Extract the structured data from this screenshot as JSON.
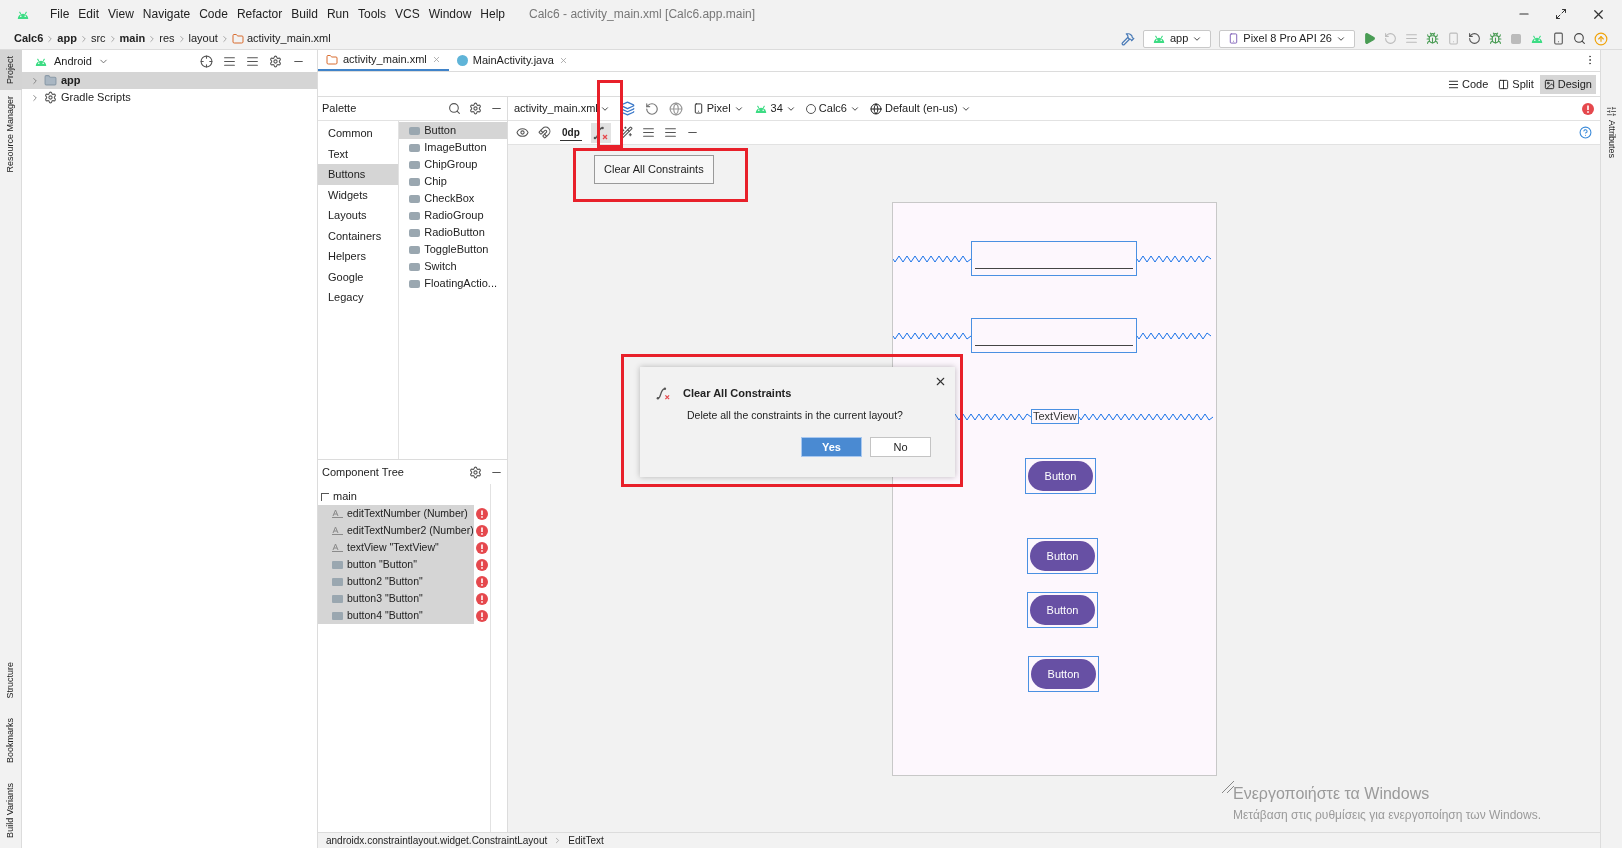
{
  "menu": [
    "File",
    "Edit",
    "View",
    "Navigate",
    "Code",
    "Refactor",
    "Build",
    "Run",
    "Tools",
    "VCS",
    "Window",
    "Help"
  ],
  "window_title": "Calc6 - activity_main.xml [Calc6.app.main]",
  "breadcrumbs": [
    {
      "label": "Calc6",
      "bold": true
    },
    {
      "label": "app",
      "bold": true
    },
    {
      "label": "src",
      "bold": false
    },
    {
      "label": "main",
      "bold": true
    },
    {
      "label": "res",
      "bold": false
    },
    {
      "label": "layout",
      "bold": false
    },
    {
      "label": "activity_main.xml",
      "bold": false
    }
  ],
  "run_config": "app",
  "device": "Pixel 8 Pro API 26",
  "left_strip": [
    {
      "label": "Project",
      "selected": true
    },
    {
      "label": "Resource Manager",
      "selected": false
    }
  ],
  "left_strip_bottom": [
    {
      "label": "Structure"
    },
    {
      "label": "Bookmarks"
    },
    {
      "label": "Build Variants"
    }
  ],
  "right_strip": [
    "Attributes"
  ],
  "project": {
    "view": "Android",
    "items": [
      {
        "label": "app",
        "selected": true,
        "kind": "module"
      },
      {
        "label": "Gradle Scripts",
        "selected": false,
        "kind": "gradle"
      }
    ]
  },
  "editor_tabs": [
    {
      "label": "activity_main.xml",
      "selected": true,
      "kind": "xml"
    },
    {
      "label": "MainActivity.java",
      "selected": false,
      "kind": "java"
    }
  ],
  "view_modes": [
    {
      "label": "Code",
      "selected": false
    },
    {
      "label": "Split",
      "selected": false
    },
    {
      "label": "Design",
      "selected": true
    }
  ],
  "palette": {
    "title": "Palette",
    "categories": [
      {
        "label": "Common",
        "selected": false
      },
      {
        "label": "Text",
        "selected": false
      },
      {
        "label": "Buttons",
        "selected": true
      },
      {
        "label": "Widgets",
        "selected": false
      },
      {
        "label": "Layouts",
        "selected": false
      },
      {
        "label": "Containers",
        "selected": false
      },
      {
        "label": "Helpers",
        "selected": false
      },
      {
        "label": "Google",
        "selected": false
      },
      {
        "label": "Legacy",
        "selected": false
      }
    ],
    "items": [
      {
        "label": "Button",
        "selected": true
      },
      {
        "label": "ImageButton",
        "selected": false
      },
      {
        "label": "ChipGroup",
        "selected": false
      },
      {
        "label": "Chip",
        "selected": false
      },
      {
        "label": "CheckBox",
        "selected": false
      },
      {
        "label": "RadioGroup",
        "selected": false
      },
      {
        "label": "RadioButton",
        "selected": false
      },
      {
        "label": "ToggleButton",
        "selected": false
      },
      {
        "label": "Switch",
        "selected": false
      },
      {
        "label": "FloatingActio...",
        "selected": false
      }
    ]
  },
  "design_toolbar": {
    "file": "activity_main.xml",
    "device": "Pixel",
    "api": "34",
    "theme": "Calc6",
    "locale": "Default (en-us)",
    "margin": "0dp"
  },
  "tooltip": "Clear All Constraints",
  "component_tree": {
    "title": "Component Tree",
    "root": "main",
    "children": [
      {
        "label": "editTextNumber (Number)",
        "kind": "text",
        "selected": true,
        "error": true
      },
      {
        "label": "editTextNumber2 (Number)",
        "kind": "text",
        "selected": true,
        "error": true
      },
      {
        "label": "textView \"TextView\"",
        "kind": "text",
        "selected": true,
        "error": true
      },
      {
        "label": "button \"Button\"",
        "kind": "button",
        "selected": true,
        "error": true
      },
      {
        "label": "button2 \"Button\"",
        "kind": "button",
        "selected": true,
        "error": true
      },
      {
        "label": "button3 \"Button\"",
        "kind": "button",
        "selected": true,
        "error": true
      },
      {
        "label": "button4 \"Button\"",
        "kind": "button",
        "selected": true,
        "error": true
      }
    ]
  },
  "canvas": {
    "widgets": [
      {
        "kind": "edittext"
      },
      {
        "kind": "edittext"
      },
      {
        "kind": "textview",
        "text": "TextView"
      },
      {
        "kind": "button",
        "text": "Button"
      },
      {
        "kind": "button",
        "text": "Button"
      },
      {
        "kind": "button",
        "text": "Button"
      },
      {
        "kind": "button",
        "text": "Button"
      }
    ]
  },
  "dialog": {
    "title": "Clear All Constraints",
    "message": "Delete all the constraints in the current layout?",
    "buttons": [
      {
        "label": "Yes",
        "primary": true
      },
      {
        "label": "No",
        "primary": false
      }
    ]
  },
  "status_path": [
    "androidx.constraintlayout.widget.ConstraintLayout",
    "EditText"
  ],
  "os_notice": {
    "title": "Ενεργοποιήστε τα Windows",
    "subtitle": "Μετάβαση στις ρυθμίσεις για ενεργοποίηση των Windows."
  }
}
